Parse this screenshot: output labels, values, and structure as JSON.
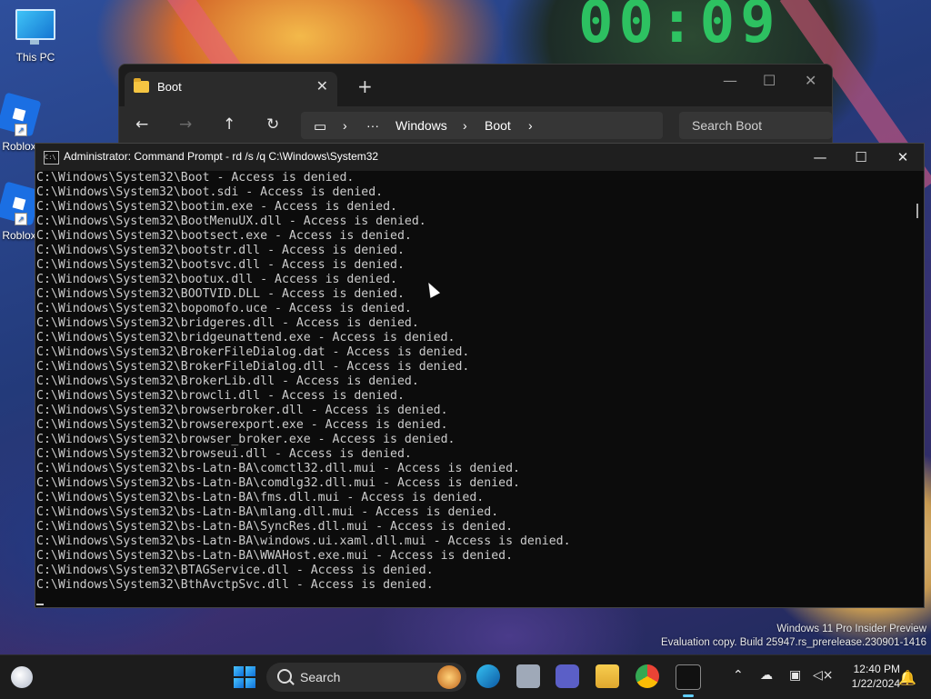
{
  "desktop": {
    "icons": [
      {
        "label": "This PC"
      },
      {
        "label": "Roblox"
      },
      {
        "label": "Roblox"
      }
    ],
    "watermark": {
      "line1": "Windows 11 Pro Insider Preview",
      "line2": "Evaluation copy. Build 25947.rs_prerelease.230901-1416"
    }
  },
  "explorer": {
    "tab_title": "Boot",
    "breadcrumb": [
      "Windows",
      "Boot"
    ],
    "search_placeholder": "Search Boot"
  },
  "cmd": {
    "title": "Administrator: Command Prompt - rd  /s /q C:\\Windows\\System32",
    "lines": [
      "C:\\Windows\\System32\\Boot - Access is denied.",
      "C:\\Windows\\System32\\boot.sdi - Access is denied.",
      "C:\\Windows\\System32\\bootim.exe - Access is denied.",
      "C:\\Windows\\System32\\BootMenuUX.dll - Access is denied.",
      "C:\\Windows\\System32\\bootsect.exe - Access is denied.",
      "C:\\Windows\\System32\\bootstr.dll - Access is denied.",
      "C:\\Windows\\System32\\bootsvc.dll - Access is denied.",
      "C:\\Windows\\System32\\bootux.dll - Access is denied.",
      "C:\\Windows\\System32\\BOOTVID.DLL - Access is denied.",
      "C:\\Windows\\System32\\bopomofo.uce - Access is denied.",
      "C:\\Windows\\System32\\bridgeres.dll - Access is denied.",
      "C:\\Windows\\System32\\bridgeunattend.exe - Access is denied.",
      "C:\\Windows\\System32\\BrokerFileDialog.dat - Access is denied.",
      "C:\\Windows\\System32\\BrokerFileDialog.dll - Access is denied.",
      "C:\\Windows\\System32\\BrokerLib.dll - Access is denied.",
      "C:\\Windows\\System32\\browcli.dll - Access is denied.",
      "C:\\Windows\\System32\\browserbroker.dll - Access is denied.",
      "C:\\Windows\\System32\\browserexport.exe - Access is denied.",
      "C:\\Windows\\System32\\browser_broker.exe - Access is denied.",
      "C:\\Windows\\System32\\browseui.dll - Access is denied.",
      "C:\\Windows\\System32\\bs-Latn-BA\\comctl32.dll.mui - Access is denied.",
      "C:\\Windows\\System32\\bs-Latn-BA\\comdlg32.dll.mui - Access is denied.",
      "C:\\Windows\\System32\\bs-Latn-BA\\fms.dll.mui - Access is denied.",
      "C:\\Windows\\System32\\bs-Latn-BA\\mlang.dll.mui - Access is denied.",
      "C:\\Windows\\System32\\bs-Latn-BA\\SyncRes.dll.mui - Access is denied.",
      "C:\\Windows\\System32\\bs-Latn-BA\\windows.ui.xaml.dll.mui - Access is denied.",
      "C:\\Windows\\System32\\bs-Latn-BA\\WWAHost.exe.mui - Access is denied.",
      "C:\\Windows\\System32\\BTAGService.dll - Access is denied.",
      "C:\\Windows\\System32\\BthAvctpSvc.dll - Access is denied."
    ]
  },
  "taskbar": {
    "search_label": "Search",
    "time": "12:40 PM",
    "date": "1/22/2024"
  }
}
